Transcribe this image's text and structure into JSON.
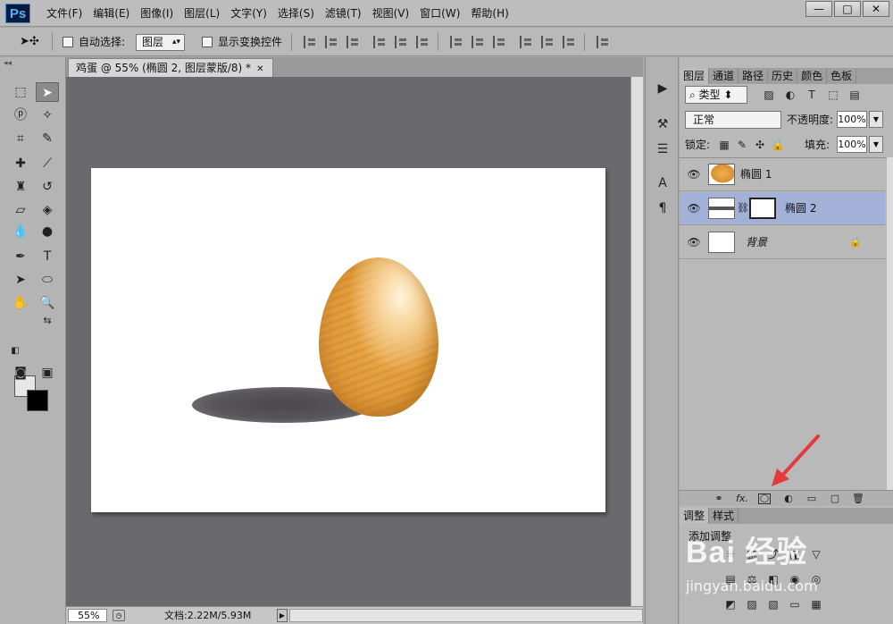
{
  "app": {
    "logo": "Ps",
    "menus": [
      "文件(F)",
      "编辑(E)",
      "图像(I)",
      "图层(L)",
      "文字(Y)",
      "选择(S)",
      "滤镜(T)",
      "视图(V)",
      "窗口(W)",
      "帮助(H)"
    ],
    "window_controls": {
      "minimize": "—",
      "restore": "□",
      "close": "✕"
    }
  },
  "options_bar": {
    "move_tool_icon": "move-arrow-icon",
    "auto_select_label": "自动选择:",
    "auto_select_value": "图层",
    "show_transform_label": "显示变换控件"
  },
  "document": {
    "tab_title": "鸡蛋 @ 55% (椭圆 2, 图层蒙版/8) *",
    "zoom": "55%",
    "doc_info": "文档:2.22M/5.93M"
  },
  "tools": [
    "marquee-icon",
    "move-icon",
    "lasso-icon",
    "magic-wand-icon",
    "crop-icon",
    "eyedropper-icon",
    "healing-brush-icon",
    "brush-icon",
    "clone-stamp-icon",
    "history-brush-icon",
    "eraser-icon",
    "paint-bucket-icon",
    "blur-icon",
    "dodge-icon",
    "pen-icon",
    "type-icon",
    "path-select-icon",
    "ellipse-icon",
    "hand-icon",
    "zoom-icon"
  ],
  "layers_panel": {
    "tabs": [
      "图层",
      "通道",
      "路径",
      "历史",
      "颜色",
      "色板"
    ],
    "filter_value": "类型",
    "blend_mode": "正常",
    "opacity_label": "不透明度:",
    "opacity_value": "100%",
    "lock_label": "锁定:",
    "fill_label": "填充:",
    "fill_value": "100%",
    "layers": [
      {
        "name": "椭圆 1",
        "selected": false
      },
      {
        "name": "椭圆 2",
        "selected": true
      },
      {
        "name": "背景",
        "selected": false
      }
    ],
    "footer_icons": [
      "link-icon",
      "fx-icon",
      "add-mask-icon",
      "adjustment-layer-icon",
      "group-folder-icon",
      "new-layer-icon",
      "trash-icon"
    ],
    "fx_label": "fx."
  },
  "adjustments_panel": {
    "tabs": [
      "调整",
      "样式"
    ],
    "title": "添加调整"
  },
  "watermark": {
    "brand": "Bai 经验",
    "url": "jingyan.baidu.com"
  },
  "colors": {
    "selection": "#a3b1d8",
    "annotation_arrow": "#e33b3b"
  }
}
